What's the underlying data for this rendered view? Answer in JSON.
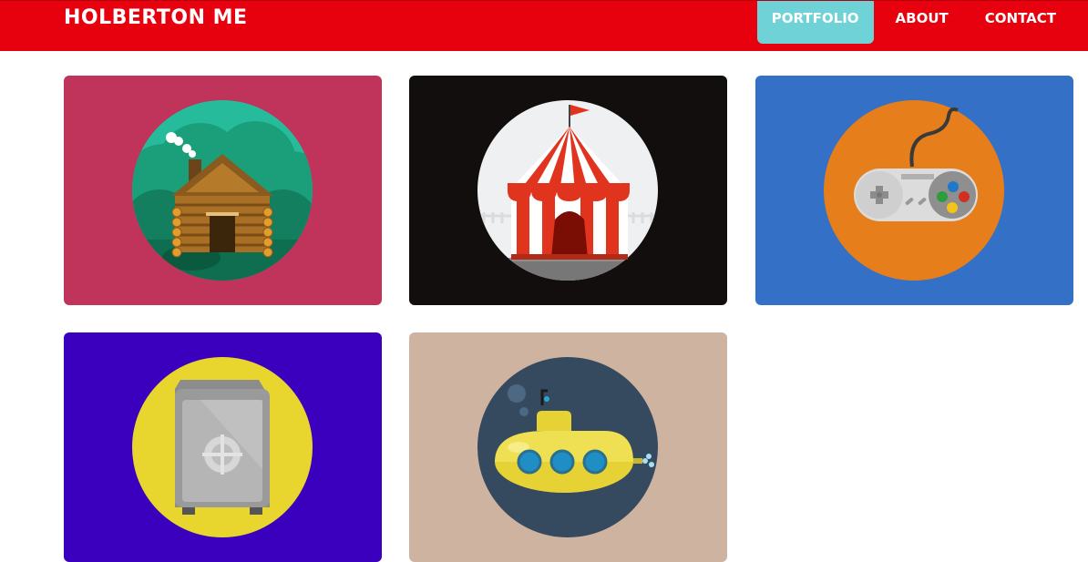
{
  "header": {
    "brand": "HOLBERTON ME",
    "nav": [
      {
        "label": "PORTFOLIO",
        "active": true
      },
      {
        "label": "ABOUT",
        "active": false
      },
      {
        "label": "CONTACT",
        "active": false
      }
    ]
  },
  "portfolio": {
    "items": [
      {
        "icon": "log-cabin-icon",
        "background": "#c0335b",
        "circle": "#26bc9b"
      },
      {
        "icon": "circus-tent-icon",
        "background": "#120e0d",
        "circle": "#eef0f1"
      },
      {
        "icon": "game-controller-icon",
        "background": "#3470c6",
        "circle": "#e67e1b"
      },
      {
        "icon": "safe-icon",
        "background": "#3a00bd",
        "circle": "#e8d62e"
      },
      {
        "icon": "submarine-icon",
        "background": "#ceb3a1",
        "circle": "#354a5f"
      }
    ]
  }
}
